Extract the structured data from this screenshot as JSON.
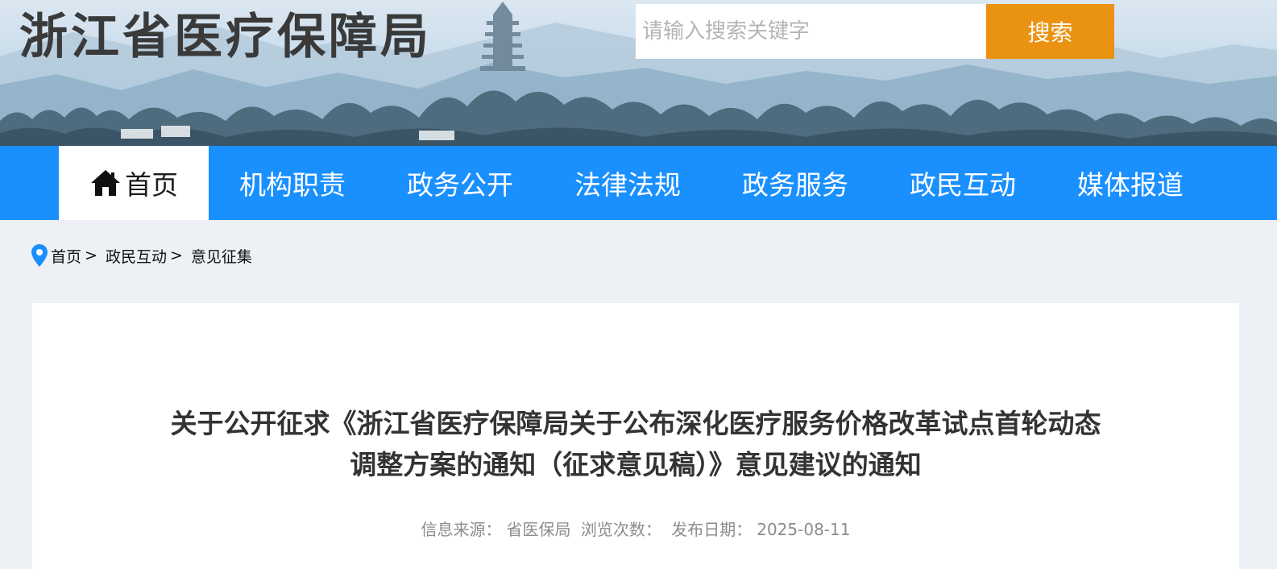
{
  "header": {
    "site_title": "浙江省医疗保障局",
    "search": {
      "placeholder": "请输入搜索关键字",
      "button_label": "搜索"
    }
  },
  "nav": {
    "items": [
      {
        "label": "首页",
        "icon": "home-icon",
        "active": true
      },
      {
        "label": "机构职责"
      },
      {
        "label": "政务公开"
      },
      {
        "label": "法律法规"
      },
      {
        "label": "政务服务"
      },
      {
        "label": "政民互动"
      },
      {
        "label": "媒体报道"
      }
    ]
  },
  "breadcrumb": {
    "icon": "location-pin-icon",
    "items": [
      "首页",
      "政民互动",
      "意见征集"
    ],
    "separator": ">"
  },
  "article": {
    "title_line1": "关于公开征求《浙江省医疗保障局关于公布深化医疗服务价格改革试点首轮动态",
    "title_line2": "调整方案的通知（征求意见稿）》意见建议的通知",
    "source_label": "信息来源：",
    "source_value": "省医保局",
    "views_label": "浏览次数：",
    "date_label": "发布日期：",
    "date_value": "2025-08-11"
  },
  "colors": {
    "nav_blue": "#1a90ff",
    "search_orange": "#ea9212",
    "page_bg": "#edf0f5",
    "title_text": "#333333",
    "meta_text": "#8c8c8c"
  }
}
